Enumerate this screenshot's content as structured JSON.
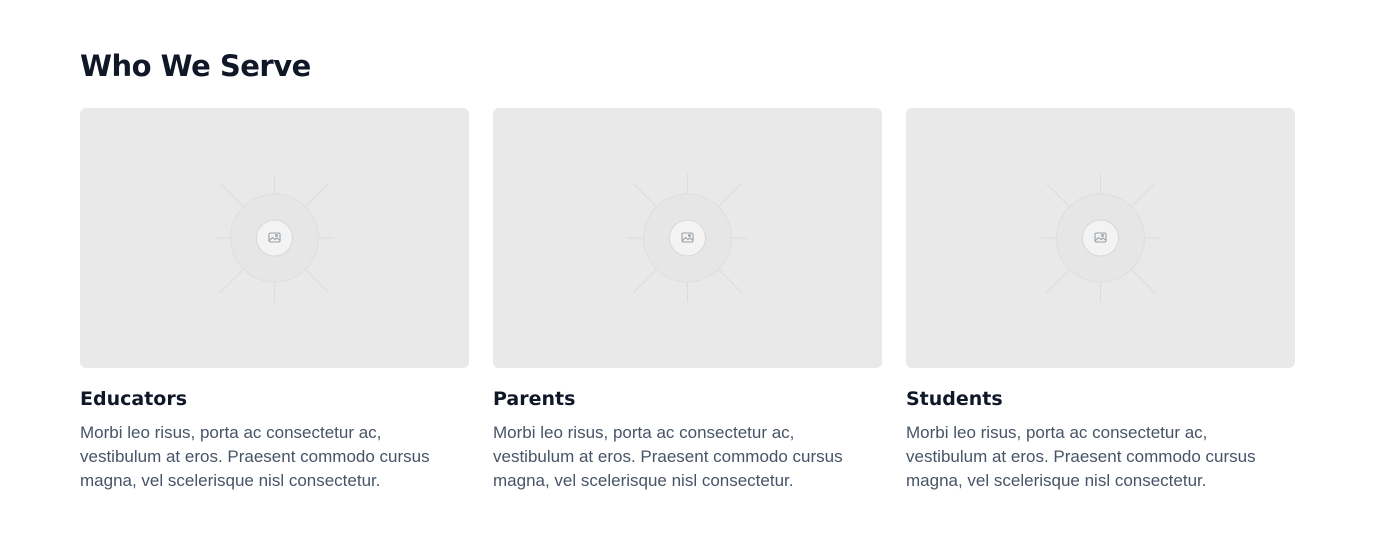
{
  "section": {
    "title": "Who We Serve"
  },
  "cards": [
    {
      "title": "Educators",
      "text": "Morbi leo risus, porta ac consectetur ac, vestibulum at eros. Praesent commodo cursus magna, vel scelerisque nisl consectetur.",
      "image_icon": "image-placeholder-icon"
    },
    {
      "title": "Parents",
      "text": "Morbi leo risus, porta ac consectetur ac, vestibulum at eros. Praesent commodo cursus magna, vel scelerisque nisl consectetur.",
      "image_icon": "image-placeholder-icon"
    },
    {
      "title": "Students",
      "text": "Morbi leo risus, porta ac consectetur ac, vestibulum at eros. Praesent commodo cursus magna, vel scelerisque nisl consectetur.",
      "image_icon": "image-placeholder-icon"
    }
  ],
  "colors": {
    "heading": "#101828",
    "body_text": "#475467",
    "placeholder_bg": "#e9e9e9"
  }
}
